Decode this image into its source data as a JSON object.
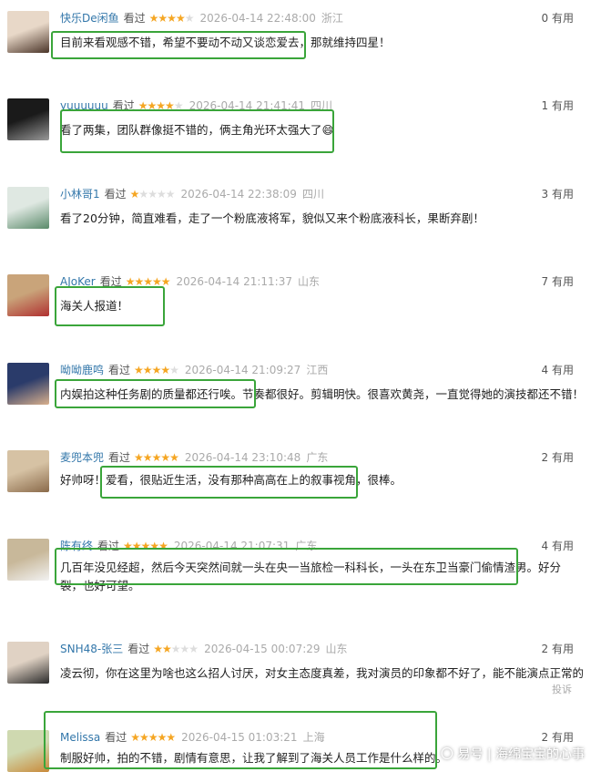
{
  "useful_suffix": "有用",
  "comments": [
    {
      "user": "快乐De闲鱼",
      "seen": "看过",
      "stars": 4,
      "date": "2026-04-14 22:48:00",
      "location": "浙江",
      "useful": "0",
      "text": "目前来看观感不错，希望不要动不动又谈恋爱去，那就维持四星！"
    },
    {
      "user": "yuuuuuu",
      "seen": "看过",
      "stars": 4,
      "date": "2026-04-14 21:41:41",
      "location": "四川",
      "useful": "1",
      "text": "看了两集，团队群像挺不错的，俩主角光环太强大了😄"
    },
    {
      "user": "小林哥1",
      "seen": "看过",
      "stars": 1,
      "date": "2026-04-14 22:38:09",
      "location": "四川",
      "useful": "3",
      "text": "看了20分钟，简直难看，走了一个粉底液将军，貌似又来个粉底液科长，果断弃剧！"
    },
    {
      "user": "AJoKer",
      "seen": "看过",
      "stars": 5,
      "date": "2026-04-14 21:11:37",
      "location": "山东",
      "useful": "7",
      "text": "海关人报道！"
    },
    {
      "user": "呦呦鹿鸣",
      "seen": "看过",
      "stars": 4,
      "date": "2026-04-14 21:09:27",
      "location": "江西",
      "useful": "4",
      "text": "内娱拍这种任务剧的质量都还行唉。节奏都很好。剪辑明快。很喜欢黄尧，一直觉得她的演技都还不错！"
    },
    {
      "user": "麦兜本兜",
      "seen": "看过",
      "stars": 5,
      "date": "2026-04-14 23:10:48",
      "location": "广东",
      "useful": "2",
      "text": "好帅呀！爱看，很贴近生活，没有那种高高在上的叙事视角，很棒。"
    },
    {
      "user": "陈有终",
      "seen": "看过",
      "stars": 5,
      "date": "2026-04-14 21:07:31",
      "location": "广东",
      "useful": "4",
      "text": "几百年没见经超，然后今天突然间就一头在央一当旅检一科科长，一头在东卫当豪门偷情渣男。好分裂，也好可望。"
    },
    {
      "user": "SNH48-张三",
      "seen": "看过",
      "stars": 2,
      "date": "2026-04-15 00:07:29",
      "location": "山东",
      "useful": "2",
      "text": "凌云彻，你在这里为啥也这么招人讨厌，对女主态度真差，我对演员的印象都不好了，能不能演点正常的",
      "report": "投诉"
    },
    {
      "user": "Melissa",
      "seen": "看过",
      "stars": 5,
      "date": "2026-04-15 01:03:21",
      "location": "上海",
      "useful": "2",
      "text": "制服好帅，拍的不错，剧情有意思，让我了解到了海关人员工作是什么样的。"
    }
  ],
  "watermark": "〇 易号 | 海绵宝宝的心事"
}
